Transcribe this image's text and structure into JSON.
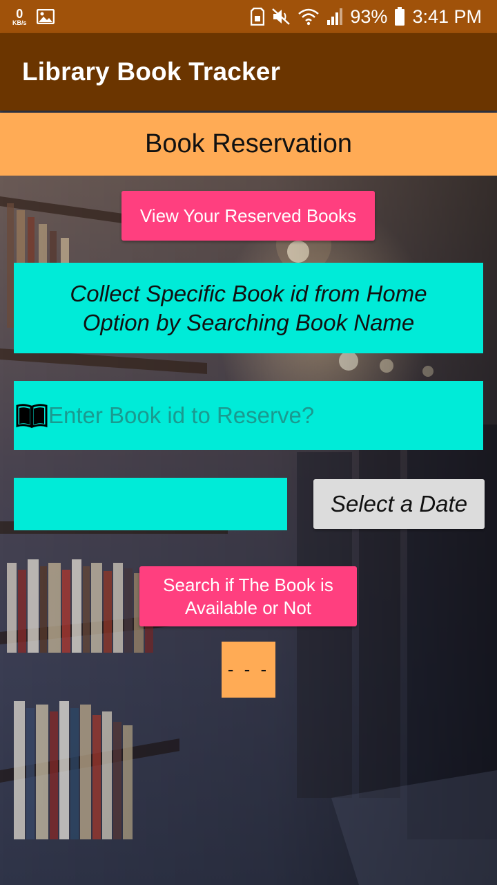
{
  "status_bar": {
    "speed_value": "0",
    "speed_unit": "KB/s",
    "battery": "93%",
    "time": "3:41 PM"
  },
  "app_bar": {
    "title": "Library Book Tracker"
  },
  "sub_header": {
    "title": "Book Reservation"
  },
  "view_reserved_button": {
    "label": "View Your Reserved Books"
  },
  "info_box": {
    "text": "Collect Specific Book id from Home Option by Searching Book Name"
  },
  "book_id_input": {
    "placeholder": "Enter Book id to Reserve?",
    "value": ""
  },
  "date_field": {
    "value": ""
  },
  "select_date_button": {
    "label": "Select a Date"
  },
  "search_button": {
    "label": "Search if The Book is\nAvailable or Not"
  },
  "result": {
    "text": "- - -"
  },
  "colors": {
    "status_bar": "#a0520a",
    "app_bar": "#6b3500",
    "sub_header": "#ffab55",
    "accent_pink": "#ff3f7f",
    "turquoise": "#00ebd8",
    "grey_button": "#dcdcdc"
  },
  "icons": {
    "status_left": [
      "image-icon"
    ],
    "status_right": [
      "sim-card-icon",
      "mute-icon",
      "wifi-icon",
      "signal-icon",
      "battery-icon"
    ],
    "input_prefix": "book-icon"
  }
}
